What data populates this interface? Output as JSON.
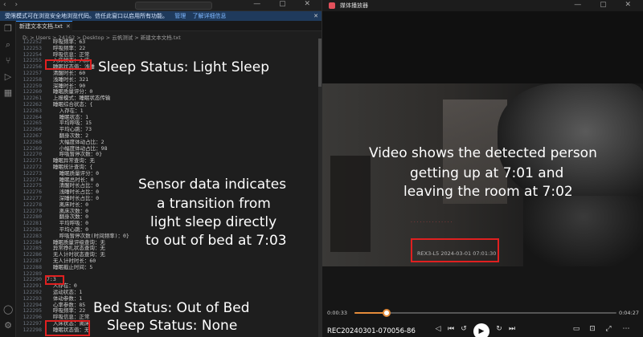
{
  "editor": {
    "banner_text": "受限模式可在浏览安全地浏览代码。信任此窗口以启用所有功能。",
    "banner_manage": "管理",
    "banner_learn": "了解详细信息",
    "tab_label": "新建文本文档.txt",
    "breadcrumb": "D: > Users > 24162 > Desktop > 云帆测试 > 新建文本文档.txt",
    "lines": [
      {
        "n": "122252",
        "t": "  呼吸频率：63"
      },
      {
        "n": "122253",
        "t": "  呼吸频率：22"
      },
      {
        "n": "122254",
        "t": "  呼吸信息：正常"
      },
      {
        "n": "122255",
        "t": "  入床状态：入床"
      },
      {
        "n": "122256",
        "t": "  睡眠状态值：浅睡"
      },
      {
        "n": "122257",
        "t": "  清醒时长：60"
      },
      {
        "n": "122258",
        "t": "  浅睡时长：321"
      },
      {
        "n": "122259",
        "t": "  深睡时长：90"
      },
      {
        "n": "122260",
        "t": "  睡眠质量评分：0"
      },
      {
        "n": "122261",
        "t": "  上报模式：睡眠状态传输"
      },
      {
        "n": "122262",
        "t": "  睡眠综合状态：{"
      },
      {
        "n": "122263",
        "t": "    入存在：1"
      },
      {
        "n": "122264",
        "t": "    睡眠状态：1"
      },
      {
        "n": "122265",
        "t": "    平均呼吸：15"
      },
      {
        "n": "122266",
        "t": "    平均心跳：73"
      },
      {
        "n": "122267",
        "t": "    翻身次数：2"
      },
      {
        "n": "122268",
        "t": "    大幅度体动占比：2"
      },
      {
        "n": "122269",
        "t": "    小幅度体动占比：98"
      },
      {
        "n": "122270",
        "t": "    呼吸暂停次数：0}"
      },
      {
        "n": "122271",
        "t": "  睡眠异常查询：无"
      },
      {
        "n": "122272",
        "t": "  睡眠统计查询：{"
      },
      {
        "n": "122273",
        "t": "    睡眠质量评分：0"
      },
      {
        "n": "122274",
        "t": "    睡眠总时长：0"
      },
      {
        "n": "122275",
        "t": "    清醒时长占比：0"
      },
      {
        "n": "122276",
        "t": "    浅睡时长占比：0"
      },
      {
        "n": "122277",
        "t": "    深睡时长占比：0"
      },
      {
        "n": "122278",
        "t": "    离床时长：0"
      },
      {
        "n": "122279",
        "t": "    离床次数：0"
      },
      {
        "n": "122280",
        "t": "    翻身次数：0"
      },
      {
        "n": "122281",
        "t": "    平均呼吸：0"
      },
      {
        "n": "122282",
        "t": "    平均心跳：0"
      },
      {
        "n": "122283",
        "t": "    呼吸暂停次数(时间频率)：0}"
      },
      {
        "n": "122284",
        "t": "  睡眠质量评级查询：无"
      },
      {
        "n": "122285",
        "t": "  异常挣扎状态查询：无"
      },
      {
        "n": "122286",
        "t": "  无人计时状态查询：无"
      },
      {
        "n": "122287",
        "t": "  无人计时时长：60"
      },
      {
        "n": "122288",
        "t": "  睡眠截止时间：5"
      },
      {
        "n": "122289",
        "t": ""
      },
      {
        "n": "122290",
        "t": "7:3"
      },
      {
        "n": "122291",
        "t": "  人存在：0"
      },
      {
        "n": "122292",
        "t": "  运动状态：1"
      },
      {
        "n": "122293",
        "t": "  体动参数：1"
      },
      {
        "n": "122294",
        "t": "  心率参数：85"
      },
      {
        "n": "122295",
        "t": "  呼吸频率：22"
      },
      {
        "n": "122296",
        "t": "  呼吸信息：正常"
      },
      {
        "n": "122297",
        "t": "  入床状态：离床"
      },
      {
        "n": "122298",
        "t": "  睡眠状态值：无"
      }
    ]
  },
  "annotations": {
    "sleep_light": "Sleep Status: Light Sleep",
    "sensor_1": "Sensor data indicates",
    "sensor_2": "a transition from",
    "sensor_3": "light sleep directly",
    "sensor_4": "to out of bed at 7:03",
    "bed_out": "Bed Status: Out of Bed",
    "sleep_none": "Sleep Status: None",
    "video_1": "Video shows the detected person",
    "video_2": "getting up at 7:01 and",
    "video_3": "leaving the room at 7:02"
  },
  "player": {
    "app_title": "媒体播放器",
    "stamp": "REX3-L5    2024-03-01    07:01:30",
    "time_current": "0:00:33",
    "time_total": "0:04:27",
    "progress": 0.124,
    "file_name": "REC20240301-070056-86"
  },
  "colors": {
    "highlight": "#e02020",
    "accent": "#e58c3a",
    "banner": "#1f3a5c"
  }
}
